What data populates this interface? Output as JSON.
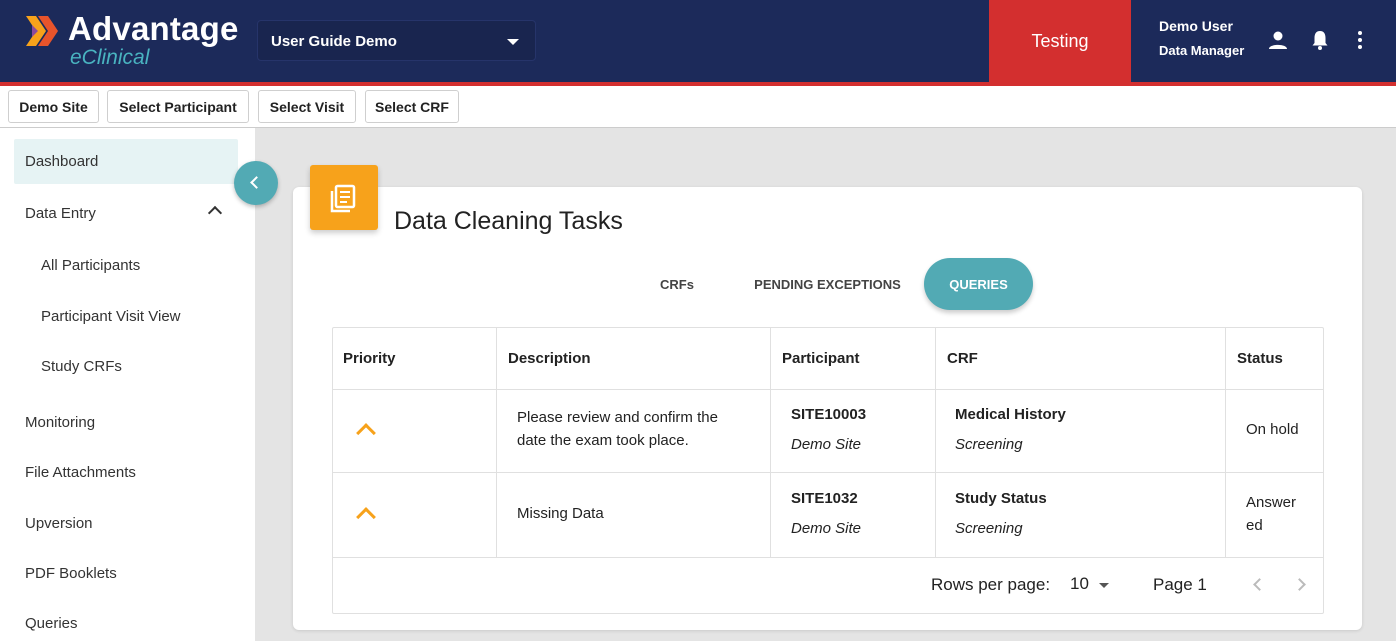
{
  "header": {
    "logo_title": "Advantage",
    "logo_subtitle": "eClinical",
    "study_select": "User Guide Demo",
    "environment": "Testing",
    "user_name": "Demo User",
    "user_role": "Data Manager",
    "icons": [
      "person-icon",
      "bell-icon",
      "more-vert-icon"
    ]
  },
  "breadcrumbs": [
    "Demo Site",
    "Select Participant",
    "Select Visit",
    "Select CRF"
  ],
  "sidebar": {
    "items": [
      {
        "label": "Dashboard",
        "active": true
      },
      {
        "label": "Data Entry",
        "expanded": true
      },
      {
        "label": "All Participants"
      },
      {
        "label": "Participant Visit View"
      },
      {
        "label": "Study CRFs"
      },
      {
        "label": "Monitoring"
      },
      {
        "label": "File Attachments"
      },
      {
        "label": "Upversion"
      },
      {
        "label": "PDF Booklets"
      },
      {
        "label": "Queries"
      }
    ]
  },
  "card": {
    "title": "Data Cleaning Tasks",
    "tabs": [
      {
        "label": "CRFs"
      },
      {
        "label": "PENDING EXCEPTIONS"
      },
      {
        "label": "QUERIES",
        "active": true
      }
    ],
    "columns": [
      "Priority",
      "Description",
      "Participant",
      "CRF",
      "Status"
    ],
    "rows": [
      {
        "priority": "high",
        "description_line1": "Please review and confirm the",
        "description_line2": "date the exam took place.",
        "participant": "SITE10003",
        "site": "Demo Site",
        "crf": "Medical History",
        "visit": "Screening",
        "status": "On hold"
      },
      {
        "priority": "high",
        "description_line1": "Missing Data",
        "participant": "SITE1032",
        "site": "Demo Site",
        "crf": "Study Status",
        "visit": "Screening",
        "status_line1": "Answer",
        "status_line2": "ed"
      }
    ],
    "pagination": {
      "rows_per_page_label": "Rows per page:",
      "rows_per_page": "10",
      "page_label": "Page 1"
    }
  },
  "colors": {
    "header_bg": "#1c2a5a",
    "accent_red": "#d32f2f",
    "accent_teal": "#52aab4",
    "accent_orange": "#f7a21b"
  }
}
